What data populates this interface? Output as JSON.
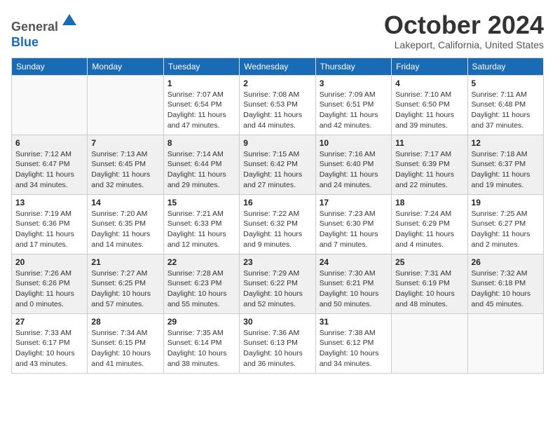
{
  "header": {
    "logo_line1": "General",
    "logo_line2": "Blue",
    "month_title": "October 2024",
    "location": "Lakeport, California, United States"
  },
  "days_of_week": [
    "Sunday",
    "Monday",
    "Tuesday",
    "Wednesday",
    "Thursday",
    "Friday",
    "Saturday"
  ],
  "weeks": [
    [
      {
        "day": "",
        "info": ""
      },
      {
        "day": "",
        "info": ""
      },
      {
        "day": "1",
        "info": "Sunrise: 7:07 AM\nSunset: 6:54 PM\nDaylight: 11 hours and 47 minutes."
      },
      {
        "day": "2",
        "info": "Sunrise: 7:08 AM\nSunset: 6:53 PM\nDaylight: 11 hours and 44 minutes."
      },
      {
        "day": "3",
        "info": "Sunrise: 7:09 AM\nSunset: 6:51 PM\nDaylight: 11 hours and 42 minutes."
      },
      {
        "day": "4",
        "info": "Sunrise: 7:10 AM\nSunset: 6:50 PM\nDaylight: 11 hours and 39 minutes."
      },
      {
        "day": "5",
        "info": "Sunrise: 7:11 AM\nSunset: 6:48 PM\nDaylight: 11 hours and 37 minutes."
      }
    ],
    [
      {
        "day": "6",
        "info": "Sunrise: 7:12 AM\nSunset: 6:47 PM\nDaylight: 11 hours and 34 minutes."
      },
      {
        "day": "7",
        "info": "Sunrise: 7:13 AM\nSunset: 6:45 PM\nDaylight: 11 hours and 32 minutes."
      },
      {
        "day": "8",
        "info": "Sunrise: 7:14 AM\nSunset: 6:44 PM\nDaylight: 11 hours and 29 minutes."
      },
      {
        "day": "9",
        "info": "Sunrise: 7:15 AM\nSunset: 6:42 PM\nDaylight: 11 hours and 27 minutes."
      },
      {
        "day": "10",
        "info": "Sunrise: 7:16 AM\nSunset: 6:40 PM\nDaylight: 11 hours and 24 minutes."
      },
      {
        "day": "11",
        "info": "Sunrise: 7:17 AM\nSunset: 6:39 PM\nDaylight: 11 hours and 22 minutes."
      },
      {
        "day": "12",
        "info": "Sunrise: 7:18 AM\nSunset: 6:37 PM\nDaylight: 11 hours and 19 minutes."
      }
    ],
    [
      {
        "day": "13",
        "info": "Sunrise: 7:19 AM\nSunset: 6:36 PM\nDaylight: 11 hours and 17 minutes."
      },
      {
        "day": "14",
        "info": "Sunrise: 7:20 AM\nSunset: 6:35 PM\nDaylight: 11 hours and 14 minutes."
      },
      {
        "day": "15",
        "info": "Sunrise: 7:21 AM\nSunset: 6:33 PM\nDaylight: 11 hours and 12 minutes."
      },
      {
        "day": "16",
        "info": "Sunrise: 7:22 AM\nSunset: 6:32 PM\nDaylight: 11 hours and 9 minutes."
      },
      {
        "day": "17",
        "info": "Sunrise: 7:23 AM\nSunset: 6:30 PM\nDaylight: 11 hours and 7 minutes."
      },
      {
        "day": "18",
        "info": "Sunrise: 7:24 AM\nSunset: 6:29 PM\nDaylight: 11 hours and 4 minutes."
      },
      {
        "day": "19",
        "info": "Sunrise: 7:25 AM\nSunset: 6:27 PM\nDaylight: 11 hours and 2 minutes."
      }
    ],
    [
      {
        "day": "20",
        "info": "Sunrise: 7:26 AM\nSunset: 6:26 PM\nDaylight: 11 hours and 0 minutes."
      },
      {
        "day": "21",
        "info": "Sunrise: 7:27 AM\nSunset: 6:25 PM\nDaylight: 10 hours and 57 minutes."
      },
      {
        "day": "22",
        "info": "Sunrise: 7:28 AM\nSunset: 6:23 PM\nDaylight: 10 hours and 55 minutes."
      },
      {
        "day": "23",
        "info": "Sunrise: 7:29 AM\nSunset: 6:22 PM\nDaylight: 10 hours and 52 minutes."
      },
      {
        "day": "24",
        "info": "Sunrise: 7:30 AM\nSunset: 6:21 PM\nDaylight: 10 hours and 50 minutes."
      },
      {
        "day": "25",
        "info": "Sunrise: 7:31 AM\nSunset: 6:19 PM\nDaylight: 10 hours and 48 minutes."
      },
      {
        "day": "26",
        "info": "Sunrise: 7:32 AM\nSunset: 6:18 PM\nDaylight: 10 hours and 45 minutes."
      }
    ],
    [
      {
        "day": "27",
        "info": "Sunrise: 7:33 AM\nSunset: 6:17 PM\nDaylight: 10 hours and 43 minutes."
      },
      {
        "day": "28",
        "info": "Sunrise: 7:34 AM\nSunset: 6:15 PM\nDaylight: 10 hours and 41 minutes."
      },
      {
        "day": "29",
        "info": "Sunrise: 7:35 AM\nSunset: 6:14 PM\nDaylight: 10 hours and 38 minutes."
      },
      {
        "day": "30",
        "info": "Sunrise: 7:36 AM\nSunset: 6:13 PM\nDaylight: 10 hours and 36 minutes."
      },
      {
        "day": "31",
        "info": "Sunrise: 7:38 AM\nSunset: 6:12 PM\nDaylight: 10 hours and 34 minutes."
      },
      {
        "day": "",
        "info": ""
      },
      {
        "day": "",
        "info": ""
      }
    ]
  ]
}
